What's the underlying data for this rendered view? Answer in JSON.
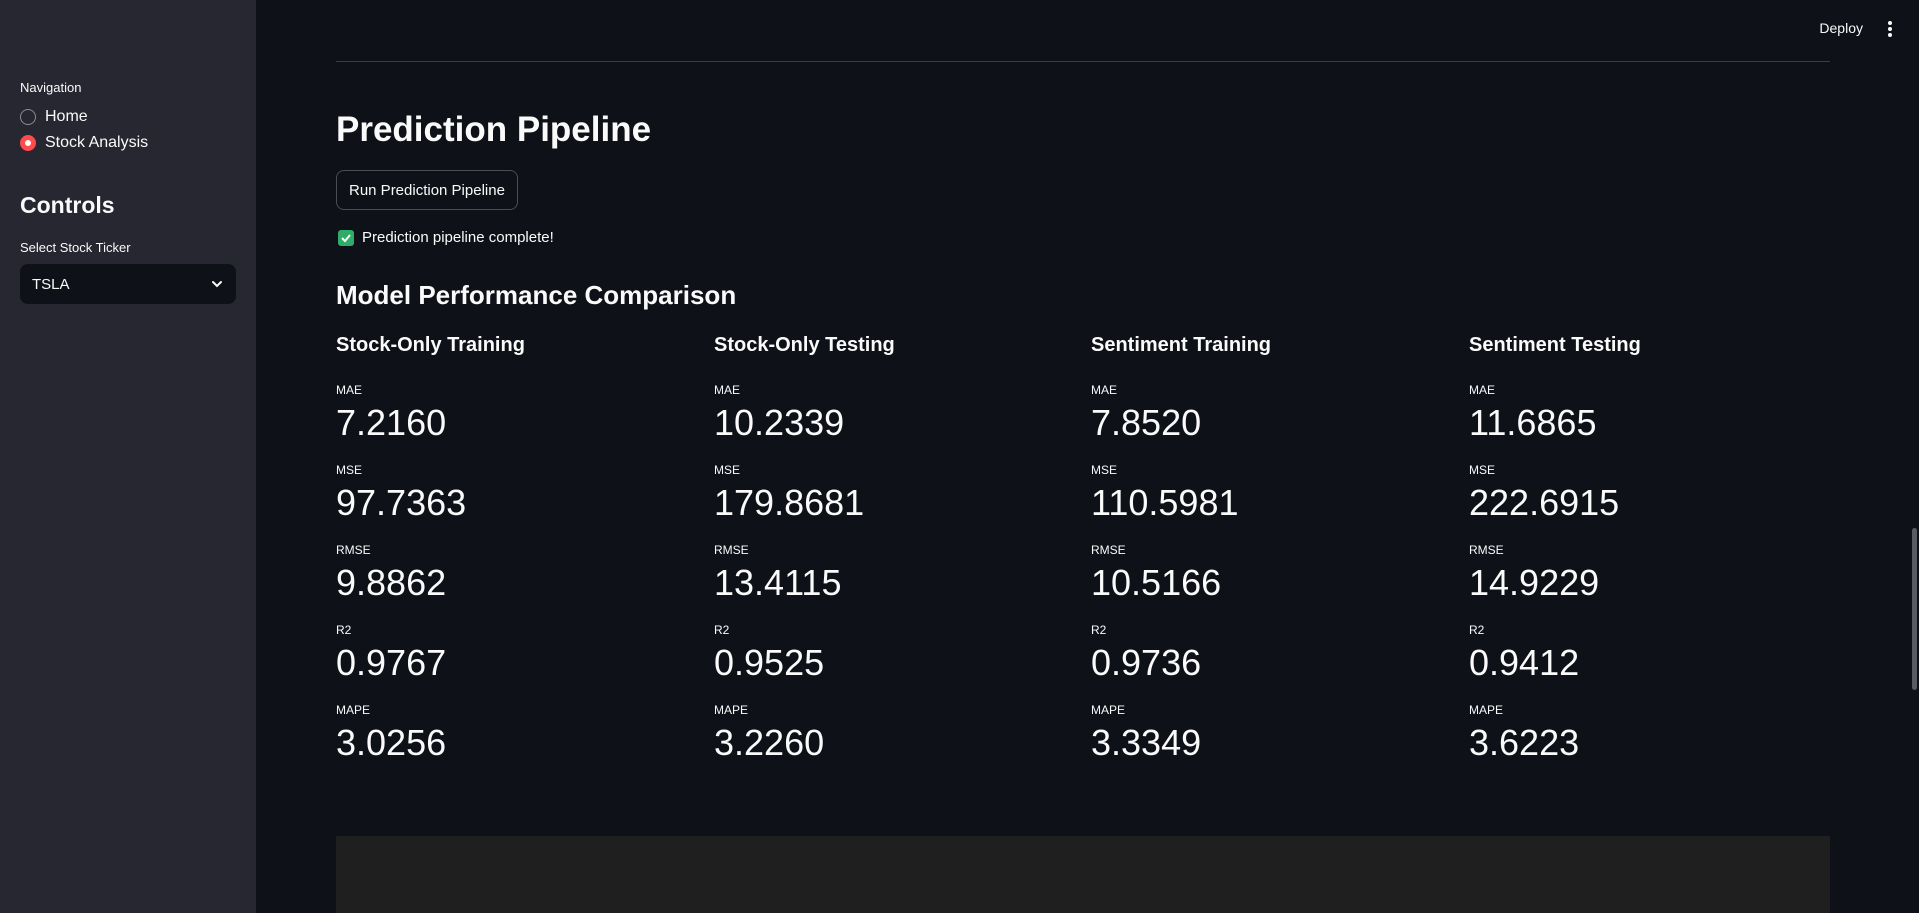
{
  "topbar": {
    "deploy_label": "Deploy"
  },
  "sidebar": {
    "nav_label": "Navigation",
    "nav_items": [
      {
        "label": "Home",
        "selected": false
      },
      {
        "label": "Stock Analysis",
        "selected": true
      }
    ],
    "controls_title": "Controls",
    "select_label": "Select Stock Ticker",
    "select_value": "TSLA"
  },
  "main": {
    "title": "Prediction Pipeline",
    "run_button": "Run Prediction Pipeline",
    "success_message": "Prediction pipeline complete!",
    "section_title": "Model Performance Comparison",
    "columns": [
      {
        "title": "Stock-Only Training",
        "metrics": [
          {
            "label": "MAE",
            "value": "7.2160"
          },
          {
            "label": "MSE",
            "value": "97.7363"
          },
          {
            "label": "RMSE",
            "value": "9.8862"
          },
          {
            "label": "R2",
            "value": "0.9767"
          },
          {
            "label": "MAPE",
            "value": "3.0256"
          }
        ]
      },
      {
        "title": "Stock-Only Testing",
        "metrics": [
          {
            "label": "MAE",
            "value": "10.2339"
          },
          {
            "label": "MSE",
            "value": "179.8681"
          },
          {
            "label": "RMSE",
            "value": "13.4115"
          },
          {
            "label": "R2",
            "value": "0.9525"
          },
          {
            "label": "MAPE",
            "value": "3.2260"
          }
        ]
      },
      {
        "title": "Sentiment Training",
        "metrics": [
          {
            "label": "MAE",
            "value": "7.8520"
          },
          {
            "label": "MSE",
            "value": "110.5981"
          },
          {
            "label": "RMSE",
            "value": "10.5166"
          },
          {
            "label": "R2",
            "value": "0.9736"
          },
          {
            "label": "MAPE",
            "value": "3.3349"
          }
        ]
      },
      {
        "title": "Sentiment Testing",
        "metrics": [
          {
            "label": "MAE",
            "value": "11.6865"
          },
          {
            "label": "MSE",
            "value": "222.6915"
          },
          {
            "label": "RMSE",
            "value": "14.9229"
          },
          {
            "label": "R2",
            "value": "0.9412"
          },
          {
            "label": "MAPE",
            "value": "3.6223"
          }
        ]
      }
    ]
  },
  "colors": {
    "accent": "#ff4b4b",
    "success": "#2eac68",
    "background": "#0e1117",
    "sidebar": "#262730"
  }
}
